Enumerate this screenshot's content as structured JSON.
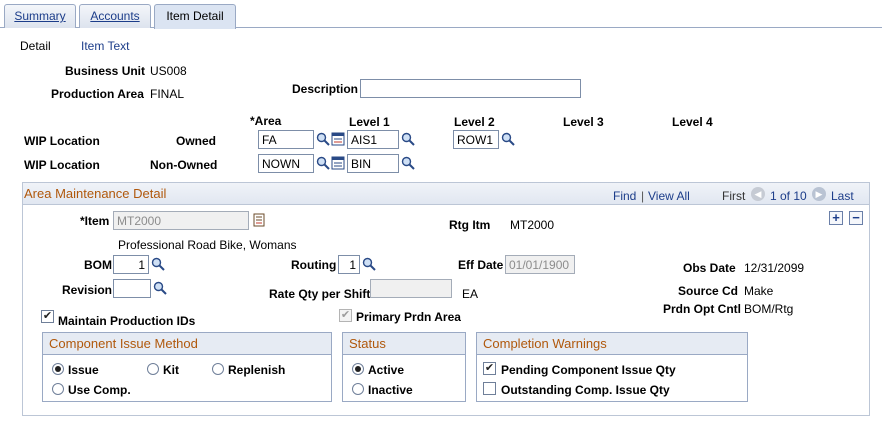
{
  "tabs": [
    {
      "label": "Summary"
    },
    {
      "label": "Accounts"
    },
    {
      "label": "Item Detail"
    }
  ],
  "subtabs": {
    "detail": "Detail",
    "item_text": "Item Text"
  },
  "header": {
    "business_unit_label": "Business Unit",
    "business_unit_value": "US008",
    "production_area_label": "Production Area",
    "production_area_value": "FINAL",
    "description_label": "Description",
    "description_value": ""
  },
  "wip": {
    "col_area": "*Area",
    "col_level1": "Level 1",
    "col_level2": "Level 2",
    "col_level3": "Level 3",
    "col_level4": "Level 4",
    "rows": [
      {
        "label": "WIP Location",
        "type": "Owned",
        "area": "FA",
        "level1": "AIS1",
        "level2": "ROW1"
      },
      {
        "label": "WIP Location",
        "type": "Non-Owned",
        "area": "NOWN",
        "level1": "BIN"
      }
    ]
  },
  "detail": {
    "title": "Area Maintenance Detail",
    "nav": {
      "find": "Find",
      "sep": "|",
      "view_all": "View All",
      "first": "First",
      "range": "1 of 10",
      "last": "Last"
    },
    "item_label": "*Item",
    "item_value": "MT2000",
    "item_desc": "Professional Road Bike, Womans",
    "rtg_itm_label": "Rtg Itm",
    "rtg_itm_value": "MT2000",
    "bom_label": "BOM",
    "bom_value": "1",
    "routing_label": "Routing",
    "routing_value": "1",
    "eff_date_label": "Eff Date",
    "eff_date_value": "01/01/1900",
    "obs_date_label": "Obs Date",
    "obs_date_value": "12/31/2099",
    "revision_label": "Revision",
    "revision_value": "",
    "rate_qty_label": "Rate Qty per Shift",
    "rate_qty_value": "",
    "rate_uom": "EA",
    "source_cd_label": "Source Cd",
    "source_cd_value": "Make",
    "prdn_opt_label": "Prdn Opt Cntl",
    "prdn_opt_value": "BOM/Rtg",
    "maintain_ids_label": "Maintain Production IDs",
    "maintain_ids_checked": true,
    "primary_area_label": "Primary Prdn Area",
    "primary_area_checked": true
  },
  "component_issue": {
    "title": "Component Issue Method",
    "options": [
      "Issue",
      "Kit",
      "Replenish",
      "Use Comp."
    ],
    "selected": "Issue"
  },
  "status": {
    "title": "Status",
    "options": [
      "Active",
      "Inactive"
    ],
    "selected": "Active"
  },
  "completion_warnings": {
    "title": "Completion Warnings",
    "items": [
      {
        "label": "Pending Component Issue Qty",
        "checked": true
      },
      {
        "label": "Outstanding Comp. Issue Qty",
        "checked": false
      }
    ]
  },
  "colors": {
    "accent_orange": "#b0580c",
    "link_blue": "#1c3d8a",
    "border_blue": "#9aa9c4"
  }
}
